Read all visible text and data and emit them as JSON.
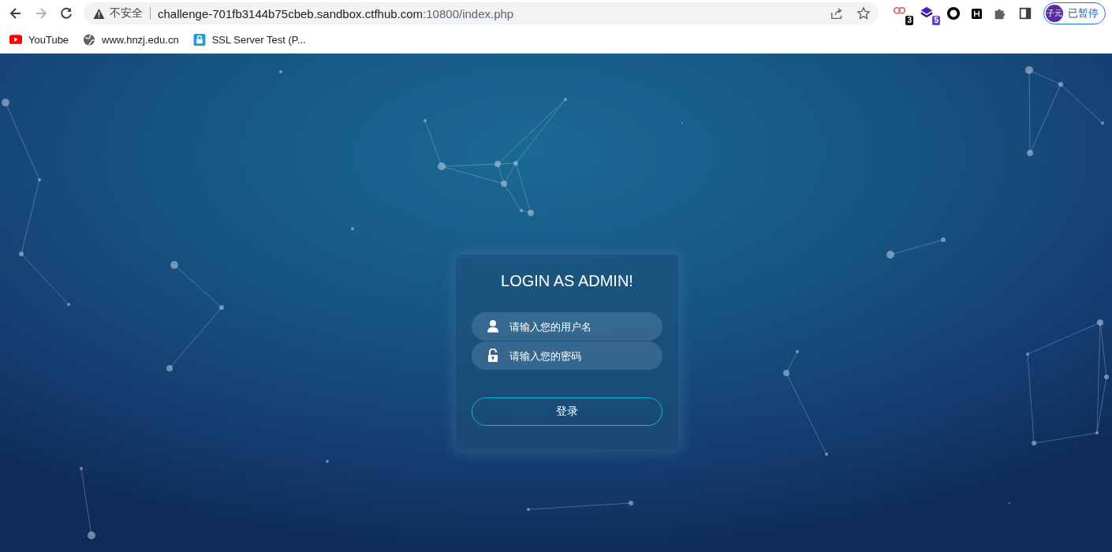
{
  "browser": {
    "address_bar": {
      "security_label": "不安全",
      "url_host": "challenge-701fb3144b75cbeb.sandbox.ctfhub.com",
      "url_rest": ":10800/index.php"
    },
    "extension_badges": [
      "3",
      "5"
    ],
    "profile": {
      "avatar": "子元",
      "status": "已暂停"
    },
    "bookmarks": [
      {
        "label": "YouTube",
        "kind": "youtube"
      },
      {
        "label": "www.hnzj.edu.cn",
        "kind": "globe"
      },
      {
        "label": "SSL Server Test (P...",
        "kind": "lock"
      }
    ]
  },
  "login": {
    "title": "LOGIN AS ADMIN!",
    "fields": [
      {
        "kind": "user",
        "placeholder": "请输入您的用户名"
      },
      {
        "kind": "password",
        "placeholder": "请输入您的密码"
      }
    ],
    "submit": "登录"
  }
}
